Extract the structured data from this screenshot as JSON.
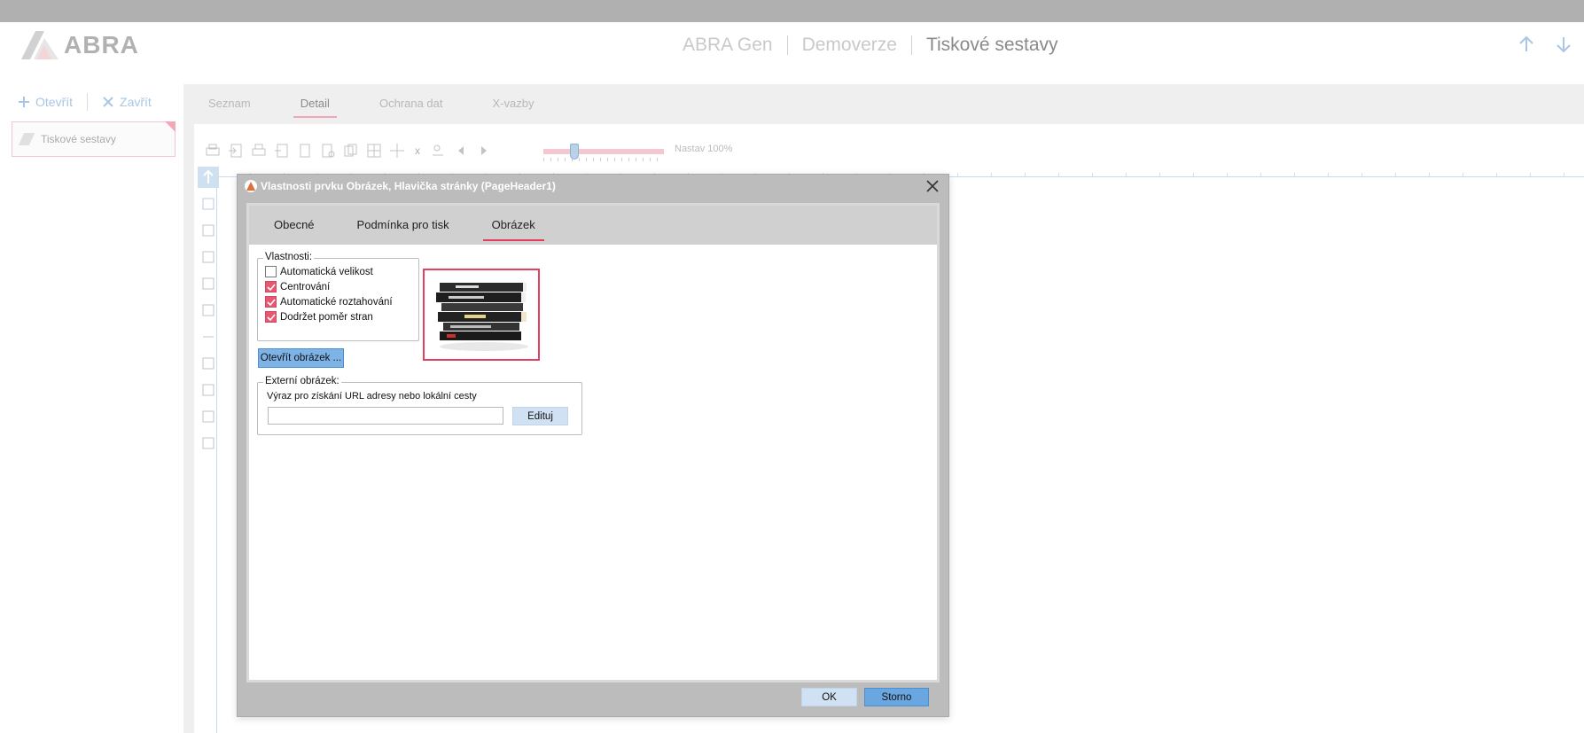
{
  "header": {
    "logo_text": "ABRA",
    "breadcrumb": [
      "ABRA Gen",
      "Demoverze",
      "Tiskové sestavy"
    ]
  },
  "left": {
    "open_label": "Otevřít",
    "close_label": "Zavřít",
    "agenda_item": "Tiskové sestavy"
  },
  "content": {
    "tabs": [
      "Seznam",
      "Detail",
      "Ochrana dat",
      "X-vazby"
    ],
    "active_tab": "Detail",
    "zoom_label": "Nastav 100%",
    "zoom_level_percent": 100
  },
  "dialog": {
    "title": "Vlastnosti prvku Obrázek, Hlavička stránky (PageHeader1)",
    "tabs": [
      "Obecné",
      "Podmínka pro tisk",
      "Obrázek"
    ],
    "active_tab": "Obrázek",
    "properties_legend": "Vlastnosti:",
    "checkboxes": [
      {
        "label": "Automatická velikost",
        "checked": false
      },
      {
        "label": "Centrování",
        "checked": true
      },
      {
        "label": "Automatické roztahování",
        "checked": true
      },
      {
        "label": "Dodržet poměr stran",
        "checked": true
      }
    ],
    "open_image_button": "Otevřít obrázek ...",
    "external_legend": "Externí obrázek:",
    "external_label": "Výraz pro získání URL adresy nebo lokální cesty",
    "external_value": "",
    "edit_button": "Edituj",
    "ok_button": "OK",
    "cancel_button": "Storno"
  },
  "colors": {
    "accent_pink": "#e33c5c",
    "primary_blue": "#6aa7e0",
    "titlebar_gray": "#bcbcbc"
  }
}
